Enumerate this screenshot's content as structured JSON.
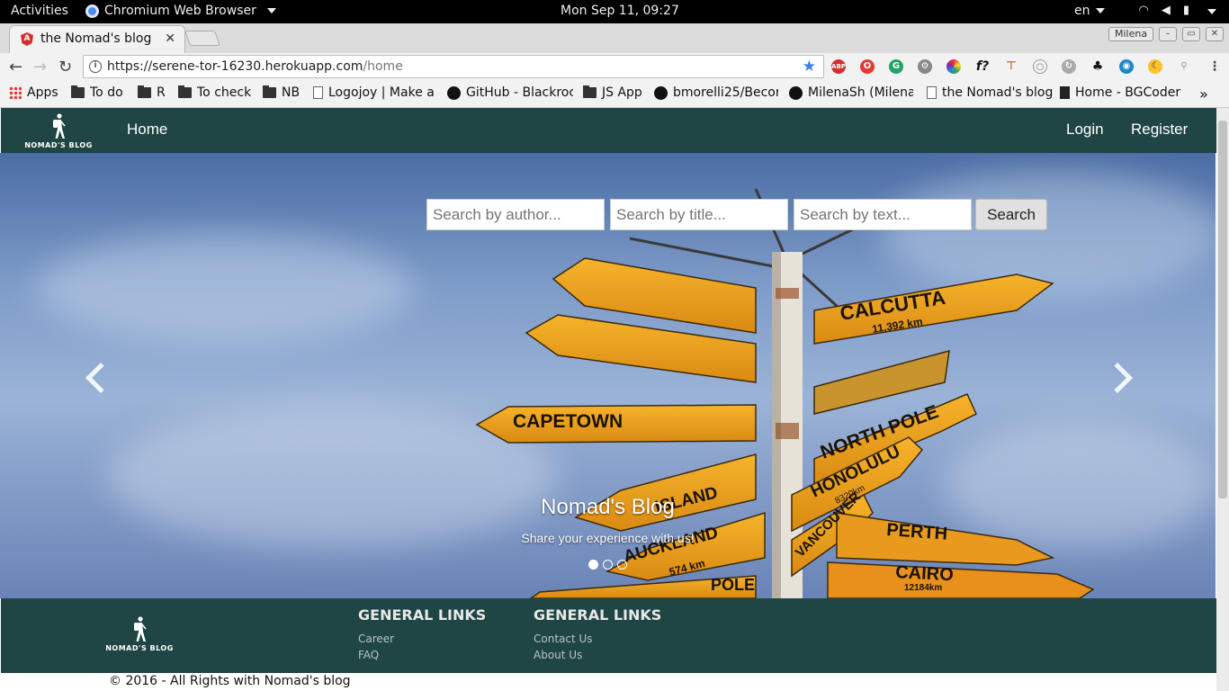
{
  "desktop": {
    "activities": "Activities",
    "app_name": "Chromium Web Browser",
    "clock": "Mon Sep 11, 09:27",
    "language": "en"
  },
  "browser": {
    "tab_title": "the Nomad's blog",
    "tab_close": "✕",
    "user_badge": "Milena",
    "url_host": "https://serene-tor-16230.herokuapp.com",
    "url_path": "/home",
    "bookmarks": [
      {
        "label": "Apps",
        "icon": "apps-grid-icon"
      },
      {
        "label": "To do",
        "icon": "folder-icon"
      },
      {
        "label": "R",
        "icon": "folder-icon"
      },
      {
        "label": "To check",
        "icon": "folder-icon"
      },
      {
        "label": "NB",
        "icon": "folder-icon"
      },
      {
        "label": "Logojoy | Make a",
        "icon": "page-icon"
      },
      {
        "label": "GitHub - Blackroc",
        "icon": "github-icon"
      },
      {
        "label": "JS App",
        "icon": "folder-icon"
      },
      {
        "label": "bmorelli25/Becor",
        "icon": "github-icon"
      },
      {
        "label": "MilenaSh (Milena",
        "icon": "github-icon"
      },
      {
        "label": "the Nomad's blog",
        "icon": "page-icon"
      },
      {
        "label": "Home - BGCoder",
        "icon": "page-icon"
      }
    ],
    "bookmarks_more": "»"
  },
  "site": {
    "logo_text": "NOMAD'S BLOG",
    "nav": {
      "home": "Home",
      "login": "Login",
      "register": "Register"
    },
    "search": {
      "author_placeholder": "Search by author...",
      "title_placeholder": "Search by title...",
      "text_placeholder": "Search by text...",
      "button": "Search"
    },
    "carousel": {
      "title": "Nomad's Blog",
      "subtitle": "Share your experience with us!",
      "slides": 3,
      "active_slide": 1,
      "signs": [
        "CALCUTTA",
        "11,392 km",
        "CAPETOWN",
        "NORTH POLE",
        "HONOLULU",
        "8320km",
        "ISLAND",
        "AUCKLAND",
        "574 km",
        "VANCOUVER",
        "PERTH",
        "CAIRO",
        "12184km",
        "POLE"
      ]
    },
    "footer": {
      "col1": {
        "heading": "GENERAL LINKS",
        "links": [
          "Career",
          "FAQ"
        ]
      },
      "col2": {
        "heading": "GENERAL LINKS",
        "links": [
          "Contact Us",
          "About Us"
        ]
      },
      "copyright": "© 2016 - All Rights with Nomad's blog"
    }
  },
  "colors": {
    "navbar": "#1f4544",
    "sign_yellow": "#f3a623",
    "sky": "#7e9cc9"
  }
}
